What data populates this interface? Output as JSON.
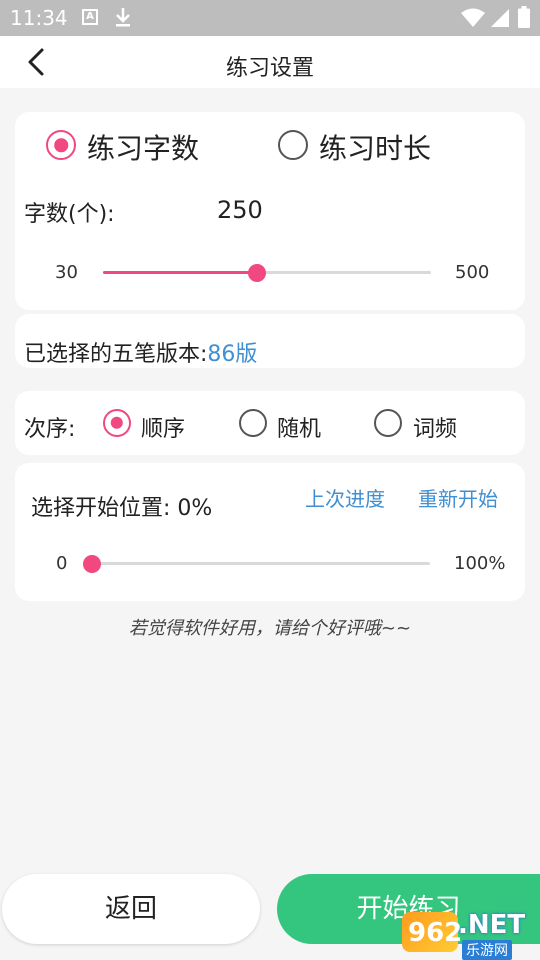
{
  "status_bar": {
    "time": "11:34",
    "a_label": "A"
  },
  "app_bar": {
    "title": "练习设置"
  },
  "mode": {
    "option_count": "练习字数",
    "option_time": "练习时长",
    "selected": "count",
    "label": "字数(个):",
    "value": "250",
    "min_label": "30",
    "max_label": "500",
    "slider_min": 30,
    "slider_max": 500,
    "slider_value": 250
  },
  "version": {
    "label": "已选择的五笔版本:",
    "value": "86版"
  },
  "order": {
    "label": "次序:",
    "options": [
      "顺序",
      "随机",
      "词频"
    ],
    "selected_index": 0
  },
  "start_position": {
    "label": "选择开始位置: 0%",
    "last_progress": "上次进度",
    "restart": "重新开始",
    "min_label": "0",
    "max_label": "100%",
    "slider_value_percent": 0
  },
  "rating_hint": "若觉得软件好用，请给个好评哦~~",
  "buttons": {
    "back": "返回",
    "start": "开始练习"
  },
  "watermark": {
    "logo_num": "962",
    "text": ".NET",
    "sub": "乐游网"
  },
  "colors": {
    "accent": "#f0487f",
    "link": "#3f8fd2",
    "start_button": "#34c67e"
  }
}
